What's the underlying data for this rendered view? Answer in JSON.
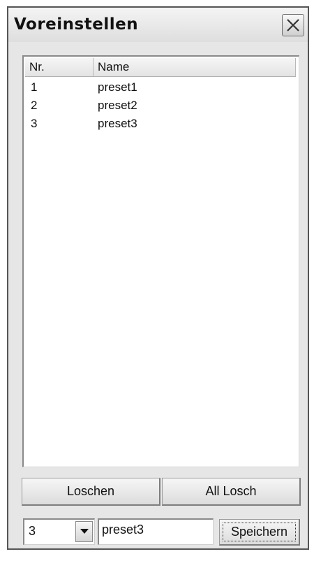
{
  "window": {
    "title": "Voreinstellen"
  },
  "list": {
    "columns": [
      "Nr.",
      "Name"
    ],
    "rows": [
      {
        "nr": "1",
        "name": "preset1"
      },
      {
        "nr": "2",
        "name": "preset2"
      },
      {
        "nr": "3",
        "name": "preset3"
      }
    ]
  },
  "buttons": {
    "delete": "Loschen",
    "delete_all": "All Losch",
    "save": "Speichern"
  },
  "preset_number": {
    "selected": "3"
  },
  "preset_name": {
    "value": "preset3"
  },
  "icons": {
    "close": "close-icon",
    "dropdown": "chevron-down-icon"
  }
}
